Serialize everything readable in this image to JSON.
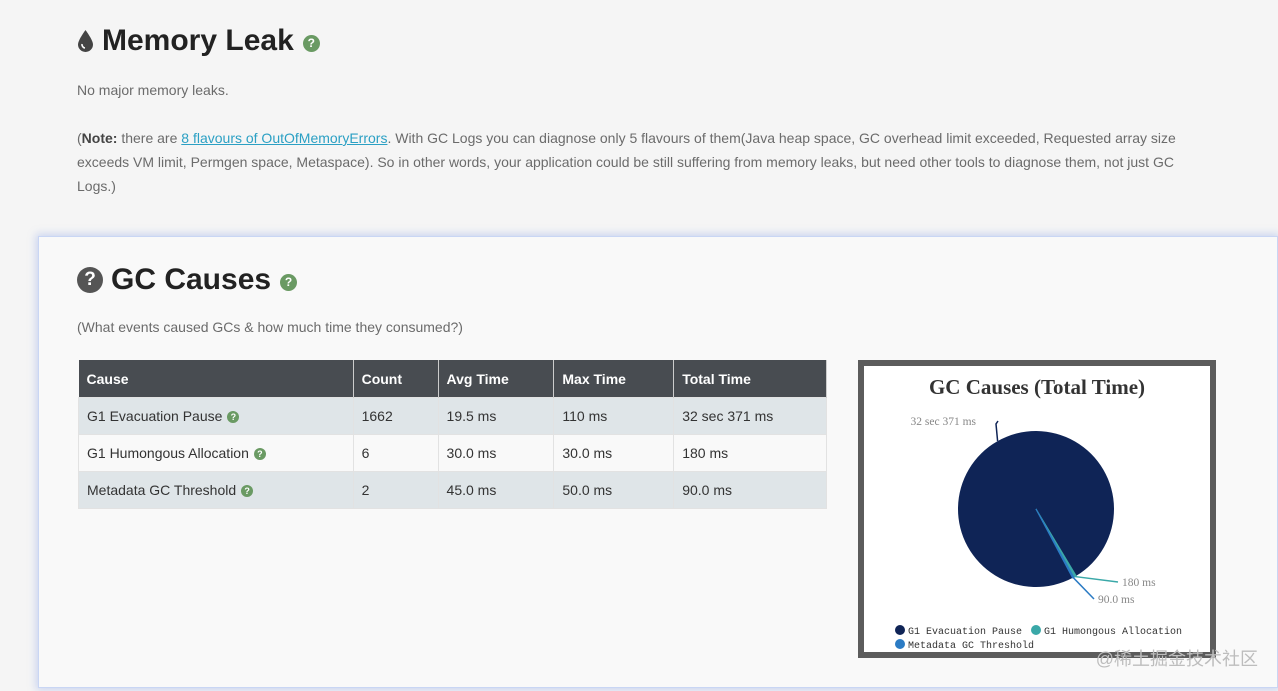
{
  "memory_leak": {
    "title": "Memory Leak",
    "status": "No major memory leaks.",
    "note_open": "(",
    "note_label": "Note:",
    "note_pre": " there are ",
    "note_link": "8 flavours of OutOfMemoryErrors",
    "note_post": ". With GC Logs you can diagnose only 5 flavours of them(Java heap space, GC overhead limit exceeded, Requested array size exceeds VM limit, Permgen space, Metaspace). So in other words, your application could be still suffering from memory leaks, but need other tools to diagnose them, not just GC Logs.)"
  },
  "gc_causes": {
    "title": "GC Causes",
    "subtitle": "(What events caused GCs & how much time they consumed?)",
    "columns": [
      "Cause",
      "Count",
      "Avg Time",
      "Max Time",
      "Total Time"
    ],
    "rows": [
      {
        "cause": "G1 Evacuation Pause",
        "count": "1662",
        "avg": "19.5 ms",
        "max": "110 ms",
        "total": "32 sec 371 ms"
      },
      {
        "cause": "G1 Humongous Allocation",
        "count": "6",
        "avg": "30.0 ms",
        "max": "30.0 ms",
        "total": "180 ms"
      },
      {
        "cause": "Metadata GC Threshold",
        "count": "2",
        "avg": "45.0 ms",
        "max": "50.0 ms",
        "total": "90.0 ms"
      }
    ]
  },
  "chart_data": {
    "type": "pie",
    "title": "GC Causes (Total Time)",
    "labels": [
      "G1 Evacuation Pause",
      "G1 Humongous Allocation",
      "Metadata GC Threshold"
    ],
    "values": [
      32371,
      180,
      90
    ],
    "value_labels": [
      "32 sec 371 ms",
      "180 ms",
      "90.0 ms"
    ],
    "colors": [
      "#0f2456",
      "#3aa8a8",
      "#2b7bc4"
    ],
    "legend_position": "bottom"
  },
  "watermark": "@稀土掘金技术社区",
  "icons": {
    "memory": "drop-icon",
    "causes": "question-circle-icon",
    "help": "help-icon"
  }
}
